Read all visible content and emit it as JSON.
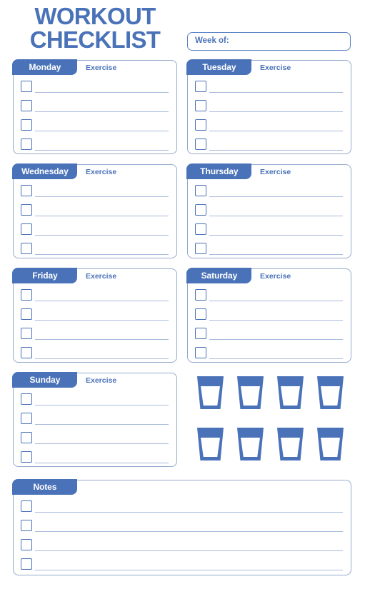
{
  "header": {
    "title_line1": "WORKOUT",
    "title_line2": "CHECKLIST",
    "week_of_label": "Week of:",
    "week_of_value": "",
    "week_of_placeholder": ""
  },
  "colors": {
    "accent": "#4a72b8",
    "card_border": "#93aace",
    "rule": "#a9bcdc",
    "background": "#ffffff"
  },
  "common": {
    "exercise_label": "Exercise",
    "rows_per_day": 4,
    "notes_rows": 4
  },
  "days": [
    {
      "name": "Monday",
      "sub": "Exercise",
      "entries": [
        "",
        "",
        "",
        ""
      ]
    },
    {
      "name": "Tuesday",
      "sub": "Exercise",
      "entries": [
        "",
        "",
        "",
        ""
      ]
    },
    {
      "name": "Wednesday",
      "sub": "Exercise",
      "entries": [
        "",
        "",
        "",
        ""
      ]
    },
    {
      "name": "Thursday",
      "sub": "Exercise",
      "entries": [
        "",
        "",
        "",
        ""
      ]
    },
    {
      "name": "Friday",
      "sub": "Exercise",
      "entries": [
        "",
        "",
        "",
        ""
      ]
    },
    {
      "name": "Saturday",
      "sub": "Exercise",
      "entries": [
        "",
        "",
        "",
        ""
      ]
    },
    {
      "name": "Sunday",
      "sub": "Exercise",
      "entries": [
        "",
        "",
        "",
        ""
      ]
    }
  ],
  "water": {
    "icon": "water-glass-icon",
    "count": 8,
    "columns": 4,
    "rows": 2,
    "filled": [
      false,
      false,
      false,
      false,
      false,
      false,
      false,
      false
    ]
  },
  "notes": {
    "name": "Notes",
    "entries": [
      "",
      "",
      "",
      ""
    ]
  }
}
